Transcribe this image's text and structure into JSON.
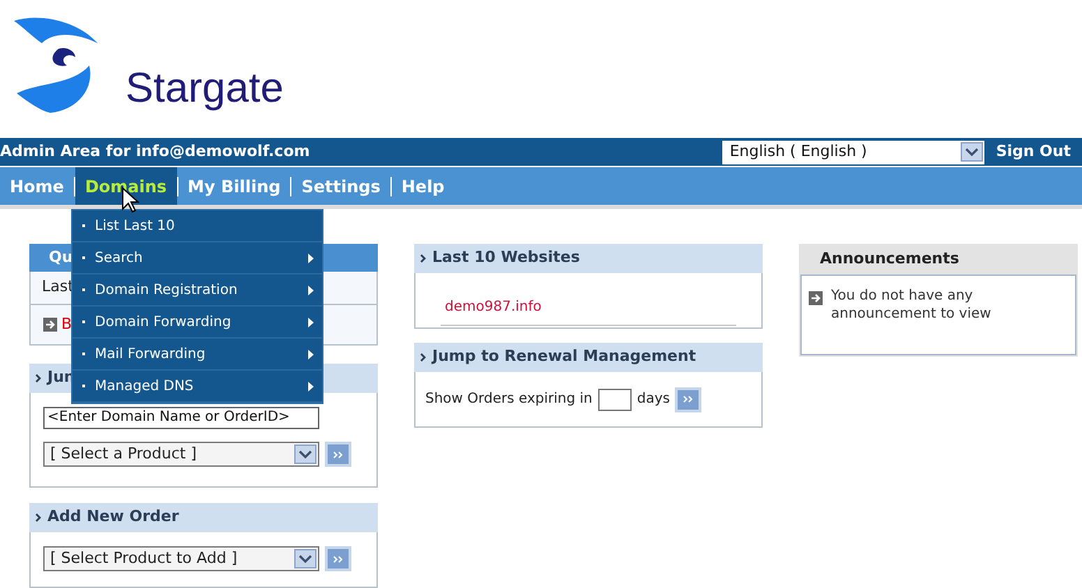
{
  "logo": {
    "name": "Stargate"
  },
  "top_bar": {
    "admin_text": "Admin Area for info@demowolf.com",
    "language": "English ( English )",
    "sign_out": "Sign Out"
  },
  "nav": [
    {
      "label": "Home",
      "selected": false
    },
    {
      "label": "Domains",
      "selected": true
    },
    {
      "label": "My Billing",
      "selected": false
    },
    {
      "label": "Settings",
      "selected": false
    },
    {
      "label": "Help",
      "selected": false
    }
  ],
  "dropdown": [
    {
      "label": "List Last 10",
      "submenu": false
    },
    {
      "label": "Search",
      "submenu": true
    },
    {
      "label": "Domain Registration",
      "submenu": true
    },
    {
      "label": "Domain Forwarding",
      "submenu": true
    },
    {
      "label": "Mail Forwarding",
      "submenu": true
    },
    {
      "label": "Managed DNS",
      "submenu": true
    }
  ],
  "quick_panel": {
    "title": "Qu",
    "rows": [
      "Last",
      "B"
    ]
  },
  "jump_panel": {
    "title": "Jun",
    "search_value": "<Enter Domain Name or OrderID>",
    "product_select": "[ Select a Product ]"
  },
  "add_order_panel": {
    "title": "Add New Order",
    "product_select": "[ Select Product to Add ]"
  },
  "websites_panel": {
    "title": "Last 10 Websites",
    "items": [
      "demo987.info"
    ]
  },
  "renewal_panel": {
    "title": "Jump to Renewal Management",
    "label_before": "Show Orders expiring in",
    "label_after": "days"
  },
  "announcements": {
    "title": "Announcements",
    "message": "You do not have any announcement to view"
  }
}
